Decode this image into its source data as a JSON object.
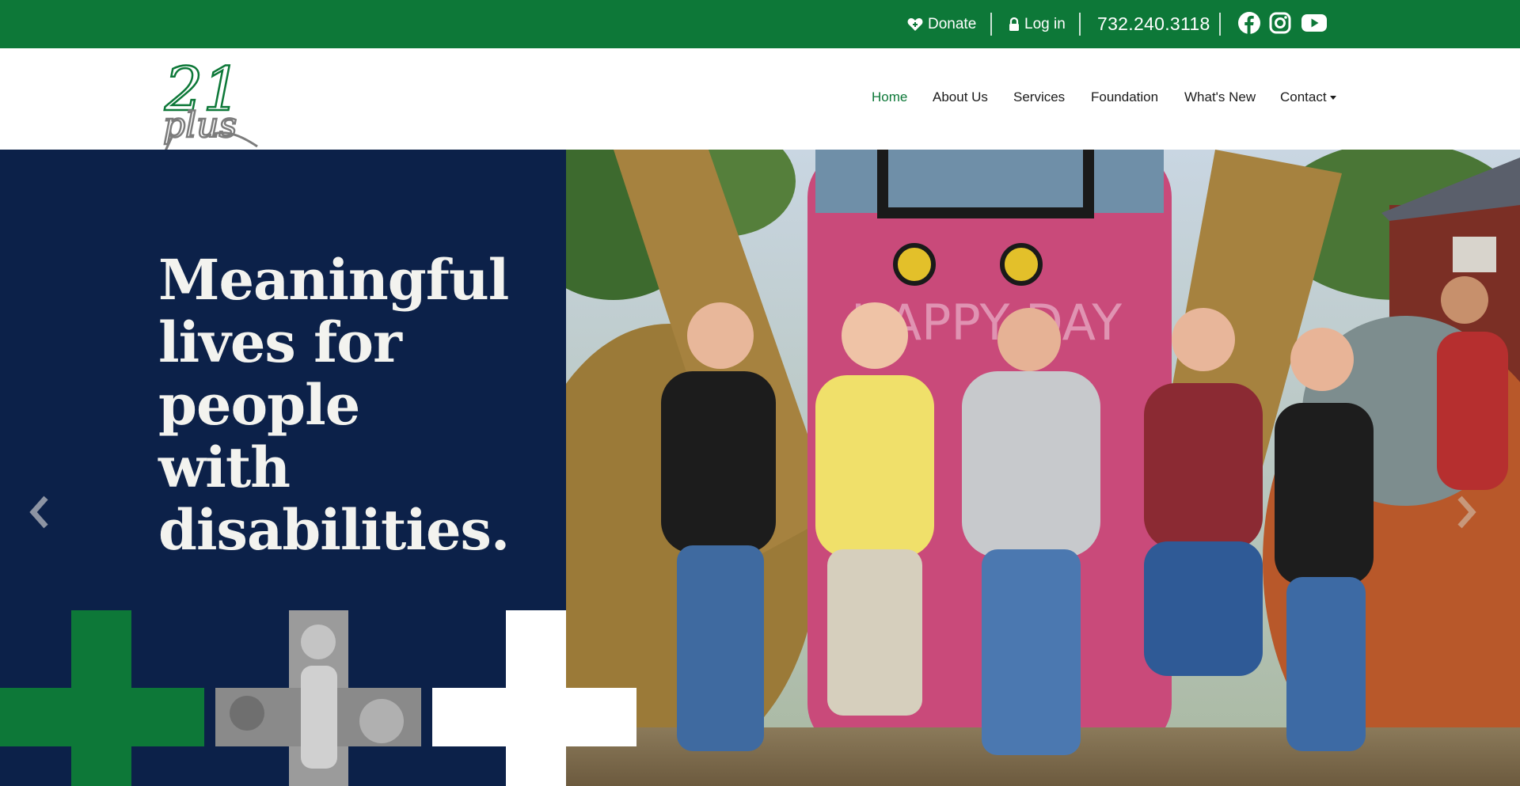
{
  "topbar": {
    "donate_label": "Donate",
    "login_label": "Log in",
    "phone": "732.240.3118",
    "social": [
      "facebook-icon",
      "instagram-icon",
      "youtube-icon"
    ]
  },
  "header": {
    "logo_text_top": "21",
    "logo_text_bottom": "plus",
    "nav": [
      {
        "label": "Home",
        "active": true
      },
      {
        "label": "About Us"
      },
      {
        "label": "Services"
      },
      {
        "label": "Foundation"
      },
      {
        "label": "What's New"
      },
      {
        "label": "Contact",
        "has_dropdown": true
      }
    ]
  },
  "hero": {
    "title": "Meaningful lives for people with disabilities."
  },
  "colors": {
    "brand_green": "#0d7838",
    "navy": "#0c2149",
    "white": "#ffffff"
  }
}
